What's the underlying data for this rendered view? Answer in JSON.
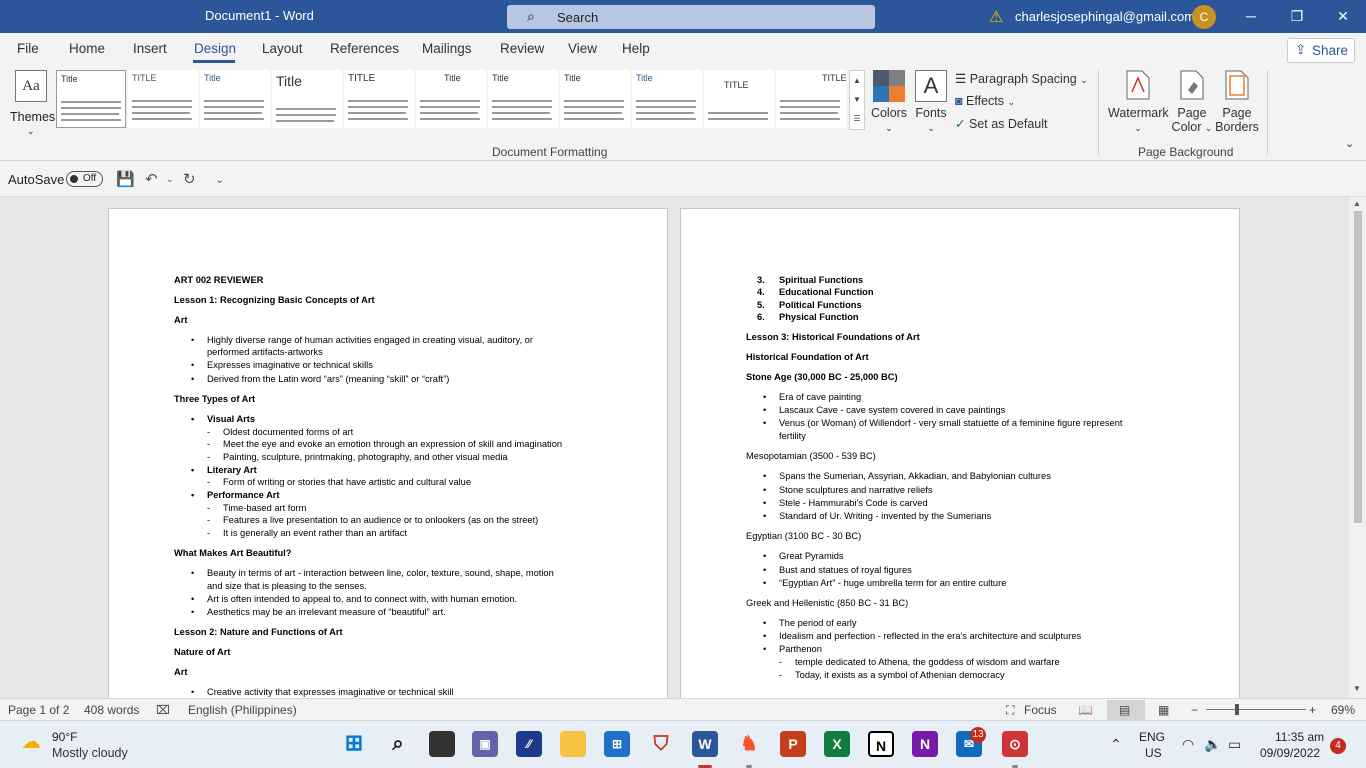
{
  "titlebar": {
    "document_title": "Document1 - Word",
    "search_placeholder": "Search",
    "account_email": "charlesjosephingal@gmail.com",
    "avatar_initial": "C",
    "minimize": "─",
    "restore": "❐",
    "close": "✕"
  },
  "tabs": [
    "File",
    "Home",
    "Insert",
    "Design",
    "Layout",
    "References",
    "Mailings",
    "Review",
    "View",
    "Help"
  ],
  "active_tab": "Design",
  "share_label": "Share",
  "ribbon": {
    "themes_label": "Themes",
    "thumbnail_titles": [
      "Title",
      "TITLE",
      "Title",
      "Title",
      "TITLE",
      "Title",
      "Title",
      "Title",
      "Title",
      "TITLE",
      "TITLE"
    ],
    "colors_label": "Colors",
    "fonts_label": "Fonts",
    "fonts_glyph": "A",
    "paragraph_spacing": "Paragraph Spacing",
    "effects": "Effects",
    "set_as_default": "Set as Default",
    "document_formatting": "Document Formatting",
    "watermark": "Watermark",
    "page_color_line1": "Page",
    "page_color_line2": "Color",
    "page_borders_line1": "Page",
    "page_borders_line2": "Borders",
    "page_background": "Page Background"
  },
  "qat": {
    "autosave_label": "AutoSave",
    "autosave_state": "Off"
  },
  "page1": {
    "lines": [
      {
        "text": "ART 002 REVIEWER",
        "bold": true,
        "indent": 0,
        "bullet": ""
      },
      {
        "text": "Lesson 1: Recognizing Basic Concepts of Art",
        "bold": true,
        "indent": 0,
        "bullet": ""
      },
      {
        "text": "Art",
        "bold": true,
        "indent": 0,
        "bullet": ""
      },
      {
        "text": "Highly diverse range of human activities engaged in creating visual, auditory, or",
        "bold": false,
        "indent": 1,
        "bullet": "•"
      },
      {
        "text": "performed artifacts-artworks",
        "bold": false,
        "indent": 1,
        "bullet": ""
      },
      {
        "text": "Expresses imaginative or technical skills",
        "bold": false,
        "indent": 1,
        "bullet": "•"
      },
      {
        "text": "Derived from the Latin word “ars” (meaning “skill” or “craft”)",
        "bold": false,
        "indent": 1,
        "bullet": "•"
      },
      {
        "text": "Three Types of Art",
        "bold": true,
        "indent": 0,
        "bullet": ""
      },
      {
        "text": "Visual Arts",
        "bold": true,
        "indent": 1,
        "bullet": "•"
      },
      {
        "text": "Oldest documented forms of art",
        "bold": false,
        "indent": 2,
        "bullet": "-"
      },
      {
        "text": "Meet the eye and evoke an emotion through an expression of skill and imagination",
        "bold": false,
        "indent": 2,
        "bullet": "-"
      },
      {
        "text": "Painting, sculpture, printmaking, photography, and other visual media",
        "bold": false,
        "indent": 2,
        "bullet": "-"
      },
      {
        "text": "Literary Art",
        "bold": true,
        "indent": 1,
        "bullet": "•"
      },
      {
        "text": "Form of writing or stories that have artistic and cultural value",
        "bold": false,
        "indent": 2,
        "bullet": "-"
      },
      {
        "text": "Performance Art",
        "bold": true,
        "indent": 1,
        "bullet": "•"
      },
      {
        "text": "Time-based art form",
        "bold": false,
        "indent": 2,
        "bullet": "-"
      },
      {
        "text": "Features a live presentation to an audience or to onlookers (as on the street)",
        "bold": false,
        "indent": 2,
        "bullet": "-"
      },
      {
        "text": "It is generally an event rather than an artifact",
        "bold": false,
        "indent": 2,
        "bullet": "-"
      },
      {
        "text": "What Makes Art Beautiful?",
        "bold": true,
        "indent": 0,
        "bullet": ""
      },
      {
        "text": "Beauty in terms of art - interaction between line, color, texture, sound, shape, motion",
        "bold": false,
        "indent": 1,
        "bullet": "•"
      },
      {
        "text": "and size that is pleasing to the senses.",
        "bold": false,
        "indent": 1,
        "bullet": ""
      },
      {
        "text": "Art is often intended to appeal to, and to connect with, with human emotion.",
        "bold": false,
        "indent": 1,
        "bullet": "•"
      },
      {
        "text": "Aesthetics may be an irrelevant measure of “beautiful” art.",
        "bold": false,
        "indent": 1,
        "bullet": "•"
      },
      {
        "text": "Lesson 2: Nature and Functions of Art",
        "bold": true,
        "indent": 0,
        "bullet": ""
      },
      {
        "text": "Nature of Art",
        "bold": true,
        "indent": 0,
        "bullet": ""
      },
      {
        "text": "Art",
        "bold": true,
        "indent": 0,
        "bullet": ""
      },
      {
        "text": "Creative activity that expresses imaginative or technical skill",
        "bold": false,
        "indent": 1,
        "bullet": "•"
      }
    ]
  },
  "page2": {
    "lines": [
      {
        "text": "Spiritual Functions",
        "bold": true,
        "indent": 1,
        "bullet": "3."
      },
      {
        "text": "Educational Function",
        "bold": true,
        "indent": 1,
        "bullet": "4."
      },
      {
        "text": "Political Functions",
        "bold": true,
        "indent": 1,
        "bullet": "5."
      },
      {
        "text": "Physical Function",
        "bold": true,
        "indent": 1,
        "bullet": "6."
      },
      {
        "text": "Lesson 3: Historical Foundations of Art",
        "bold": true,
        "indent": 0,
        "bullet": ""
      },
      {
        "text": "Historical Foundation of Art",
        "bold": true,
        "indent": 0,
        "bullet": ""
      },
      {
        "text": "Stone Age (30,000 BC - 25,000 BC)",
        "bold": true,
        "indent": 0,
        "bullet": ""
      },
      {
        "text": "Era of cave painting",
        "bold": false,
        "indent": 1,
        "bullet": "•"
      },
      {
        "text": "Lascaux Cave - cave system covered in cave paintings",
        "bold": false,
        "indent": 1,
        "bullet": "•"
      },
      {
        "text": "Venus (or Woman) of Willendorf - very small statuette of a feminine figure represent",
        "bold": false,
        "indent": 1,
        "bullet": "•"
      },
      {
        "text": "fertility",
        "bold": false,
        "indent": 1,
        "bullet": ""
      },
      {
        "text": "Mesopotamian (3500 - 539 BC)",
        "bold": false,
        "indent": 0,
        "bullet": ""
      },
      {
        "text": "Spans the Sumerian, Assyrian, Akkadian, and Babylonian cultures",
        "bold": false,
        "indent": 1,
        "bullet": "•"
      },
      {
        "text": "Stone sculptures and narrative reliefs",
        "bold": false,
        "indent": 1,
        "bullet": "•"
      },
      {
        "text": "Stele - Hammurabi’s Code is carved",
        "bold": false,
        "indent": 1,
        "bullet": "•"
      },
      {
        "text": "Standard of Ur. Writing - invented by the Sumerians",
        "bold": false,
        "indent": 1,
        "bullet": "•"
      },
      {
        "text": "Egyptian (3100 BC - 30 BC)",
        "bold": false,
        "indent": 0,
        "bullet": ""
      },
      {
        "text": "Great Pyramids",
        "bold": false,
        "indent": 1,
        "bullet": "•"
      },
      {
        "text": "Bust and statues of royal figures",
        "bold": false,
        "indent": 1,
        "bullet": "•"
      },
      {
        "text": "“Egyptian Art” - huge umbrella term for an entire culture",
        "bold": false,
        "indent": 1,
        "bullet": "•"
      },
      {
        "text": "Greek and Hellenistic (850 BC - 31 BC)",
        "bold": false,
        "indent": 0,
        "bullet": ""
      },
      {
        "text": "The period of early",
        "bold": false,
        "indent": 1,
        "bullet": "•"
      },
      {
        "text": "Idealism and perfection - reflected in the era’s architecture and sculptures",
        "bold": false,
        "indent": 1,
        "bullet": "•"
      },
      {
        "text": "Parthenon",
        "bold": false,
        "indent": 1,
        "bullet": "•"
      },
      {
        "text": "temple dedicated to Athena, the goddess of wisdom and warfare",
        "bold": false,
        "indent": 2,
        "bullet": "-"
      },
      {
        "text": "Today, it exists as a symbol of Athenian democracy",
        "bold": false,
        "indent": 2,
        "bullet": "-"
      }
    ]
  },
  "status": {
    "page": "Page 1 of 2",
    "words": "408 words",
    "language": "English (Philippines)",
    "focus": "Focus",
    "zoom_minus": "−",
    "zoom_plus": "+",
    "zoom": "69%",
    "zoom_fraction": 0.31
  },
  "taskbar": {
    "temperature": "90°F",
    "condition": "Mostly cloudy",
    "lang_line1": "ENG",
    "lang_line2": "US",
    "time": "11:35 am",
    "date": "09/09/2022",
    "notification_count": "4",
    "mail_badge": "13",
    "app_letters": {
      "word": "W",
      "powerpoint": "P",
      "excel": "X",
      "notion": "N",
      "onenote": "N"
    }
  }
}
